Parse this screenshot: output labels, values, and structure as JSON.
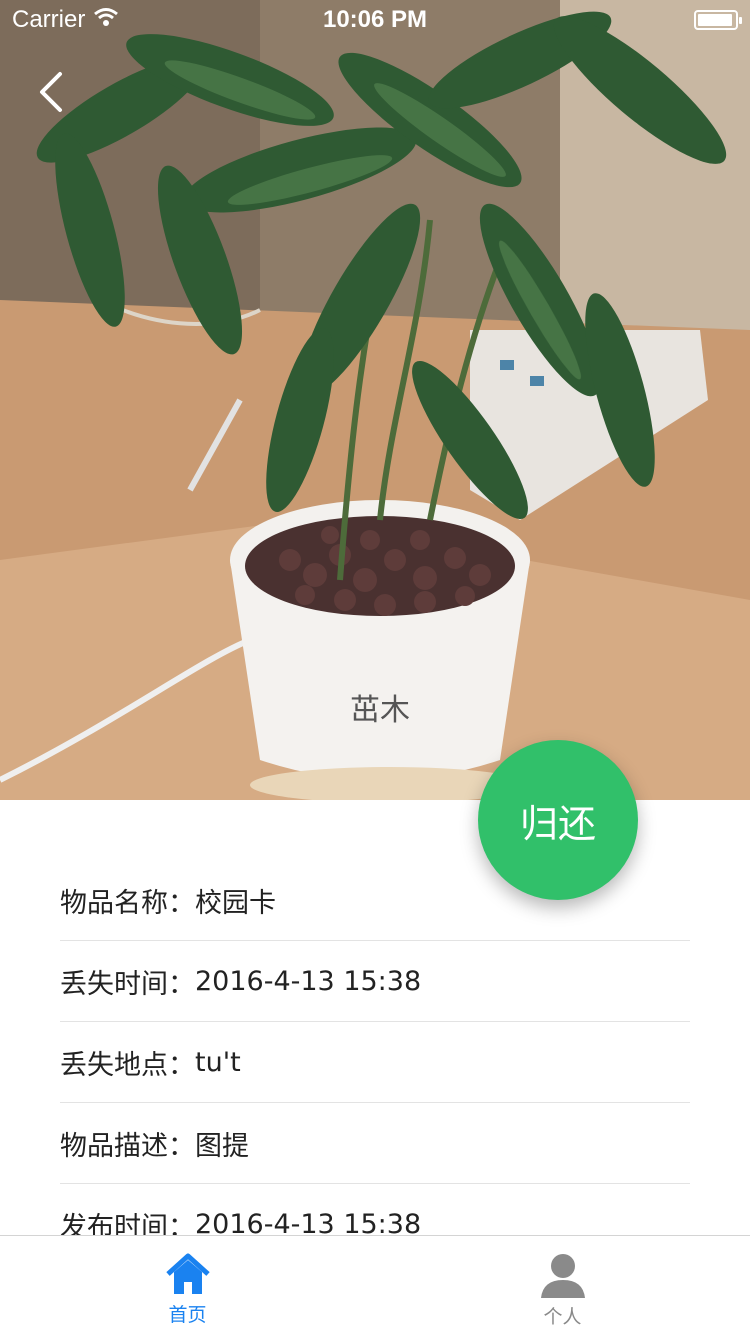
{
  "status_bar": {
    "carrier": "Carrier",
    "time": "10:06 PM",
    "battery_level": 0.95
  },
  "hero": {
    "pot_text": "茁木"
  },
  "actions": {
    "return_label": "归还"
  },
  "details": [
    {
      "label": "物品名称：",
      "value": "校园卡"
    },
    {
      "label": "丢失时间：",
      "value": "2016-4-13 15:38"
    },
    {
      "label": "丢失地点：",
      "value": "tu't"
    },
    {
      "label": "物品描述：",
      "value": "图提"
    },
    {
      "label": "发布时间：",
      "value": "2016-4-13 15:38"
    }
  ],
  "tab_bar": {
    "tabs": [
      {
        "label": "首页",
        "icon": "home-icon",
        "active": true
      },
      {
        "label": "个人",
        "icon": "person-icon",
        "active": false
      }
    ]
  },
  "colors": {
    "accent_green": "#31c06a",
    "tab_active": "#1a82f0",
    "tab_inactive": "#8a8a8a"
  }
}
